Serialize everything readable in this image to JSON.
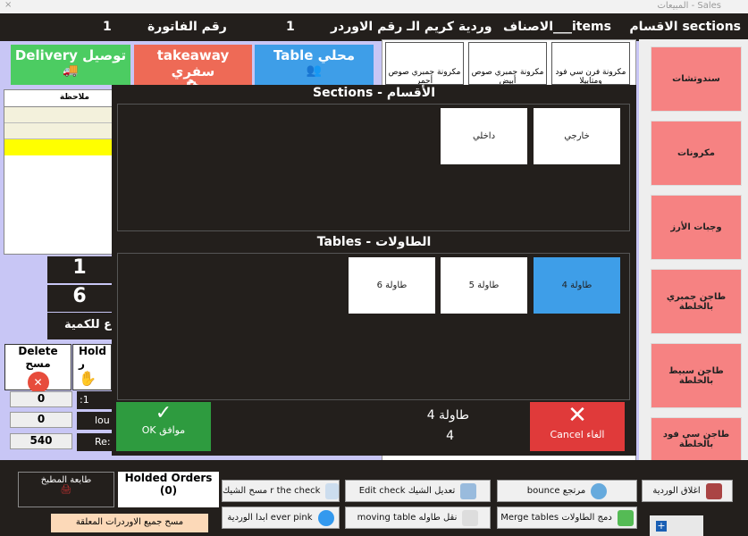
{
  "window": {
    "title": "المبيعات - Sales",
    "close": "×"
  },
  "header": {
    "sections": "الاقسام  sections",
    "items": "الاصناف___items",
    "shift": "وردية كريم الـ رقم الاوردر",
    "order_no": "1",
    "invoice_label": "رقم الفاتورة",
    "invoice_no": "1"
  },
  "order_types": [
    {
      "label": "Table محلي",
      "color": "#3e9ee8"
    },
    {
      "label": "takeaway سفري",
      "color": "#ee6a56"
    },
    {
      "label": "Delivery توصيل",
      "color": "#4ccc62"
    }
  ],
  "items": [
    "مكرونة فرن سي فود ومتابيلا",
    "مكرونة جمبري صوص أبيض",
    "مكرونة جمبري صوص أحمر"
  ],
  "sections_sidebar": [
    "سندوتشات",
    "مكرونات",
    "وجبات الأرز",
    "طاجن جمبري بالخلطة",
    "طاجن سبيط بالخلطة",
    "طاجن سي فود بالخلطة"
  ],
  "grid": {
    "note_header": "ملاحظة"
  },
  "qty": {
    "value1": "1",
    "value2": "6",
    "label": "ع للكمية"
  },
  "actions": {
    "delete": "Delete مسح",
    "hold": "Hold ر"
  },
  "totals": {
    "v1": "0",
    "v2": "0",
    "v3": "540",
    "l1": ":1",
    "l2": "lou",
    "l3": "Re:"
  },
  "modal": {
    "sections_title": "Sections  -  الأقسام",
    "sections": [
      "خارجي",
      "داخلي"
    ],
    "tables_title": "Tables - الطاولات",
    "tables": [
      "طاولة 4",
      "طاولة 5",
      "طاولة 6"
    ],
    "selected_table": "طاولة 4",
    "selected_no": "4",
    "ok": "OK موافق",
    "cancel": "Cancel الغاء"
  },
  "bottom": {
    "kitchen_printer": "طابعة المطبخ",
    "holded_orders": "Holded Orders",
    "holded_count": "(0)",
    "clear_holded": "مسح جميع الاوردرات المعلقة",
    "clear_check": "مسح الشيك r the check",
    "edit_check": "Edit check تعديل الشيك",
    "bounce": "bounce  مرتجع",
    "close_shift": "اغلاق الوردية",
    "start_shift": "ابدا الوردية ever pink",
    "moving_table": "moving table نقل طاوله",
    "merge_tables": "Merge tables دمج الطاولات"
  }
}
